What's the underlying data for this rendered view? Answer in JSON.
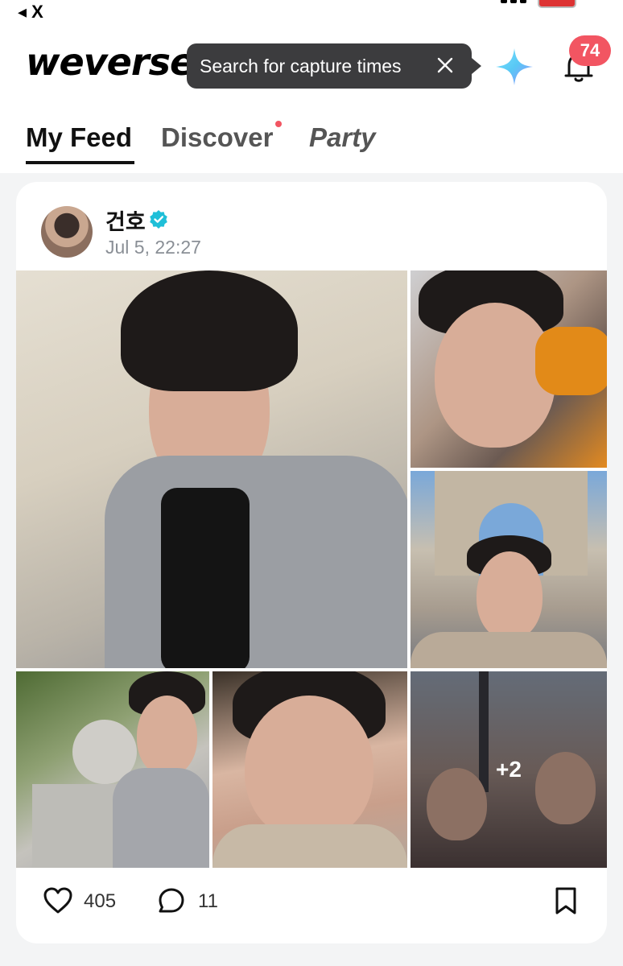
{
  "status_bar": {
    "back_label": "◂ X"
  },
  "app": {
    "logo_text": "weverse",
    "brand_color": "#111111",
    "accent_color": "#f25562"
  },
  "tooltip": {
    "text": "Search for capture times",
    "close_icon": "close-icon"
  },
  "header_icons": {
    "sparkle": "sparkle-icon",
    "bell": "bell-icon",
    "notification_count": "74"
  },
  "tabs": [
    {
      "label": "My Feed",
      "active": true
    },
    {
      "label": "Discover",
      "active": false,
      "has_dot": true
    },
    {
      "label": "Party",
      "active": false
    }
  ],
  "post": {
    "author": "건호",
    "verified": true,
    "time": "Jul 5, 22:27",
    "extra_photos_label": "+2",
    "like_count": "405",
    "comment_count": "11"
  }
}
